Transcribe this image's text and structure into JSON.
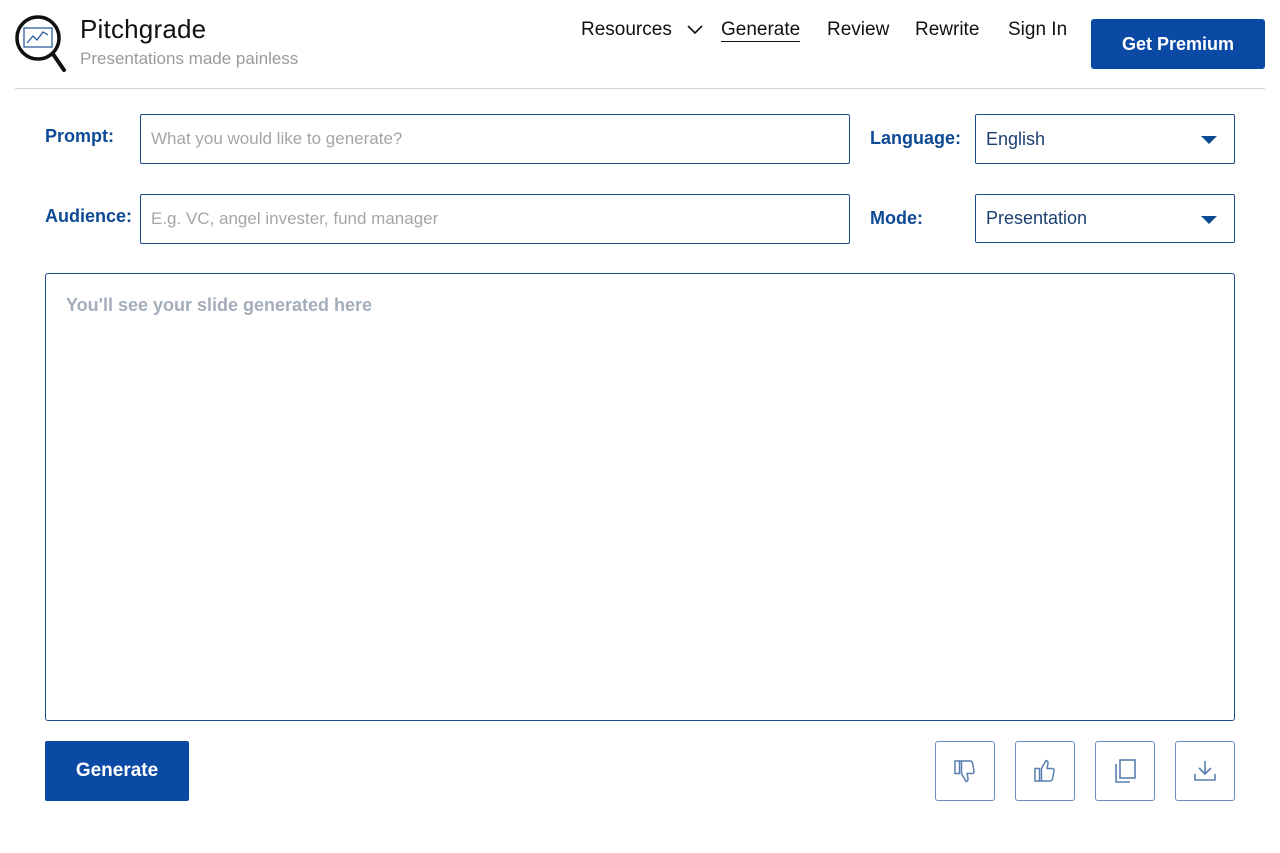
{
  "brand": {
    "name": "Pitchgrade",
    "tagline": "Presentations made painless"
  },
  "nav": {
    "items": [
      {
        "label": "Resources",
        "has_dropdown": true
      },
      {
        "label": "Generate",
        "active": true
      },
      {
        "label": "Review"
      },
      {
        "label": "Rewrite"
      },
      {
        "label": "Sign In"
      }
    ],
    "premium_label": "Get Premium"
  },
  "form": {
    "prompt_label": "Prompt:",
    "prompt_placeholder": "What you would like to generate?",
    "prompt_value": "",
    "audience_label": "Audience:",
    "audience_placeholder": "E.g. VC, angel invester, fund manager",
    "audience_value": "",
    "language_label": "Language:",
    "language_value": "English",
    "mode_label": "Mode:",
    "mode_value": "Presentation"
  },
  "output": {
    "placeholder": "You'll see your slide generated here"
  },
  "actions": {
    "generate_label": "Generate",
    "icons": [
      "thumbs-down-icon",
      "thumbs-up-icon",
      "copy-icon",
      "download-icon"
    ]
  },
  "colors": {
    "primary": "#0a4aa5",
    "label": "#0d4a94",
    "border": "#1a4d8a"
  }
}
